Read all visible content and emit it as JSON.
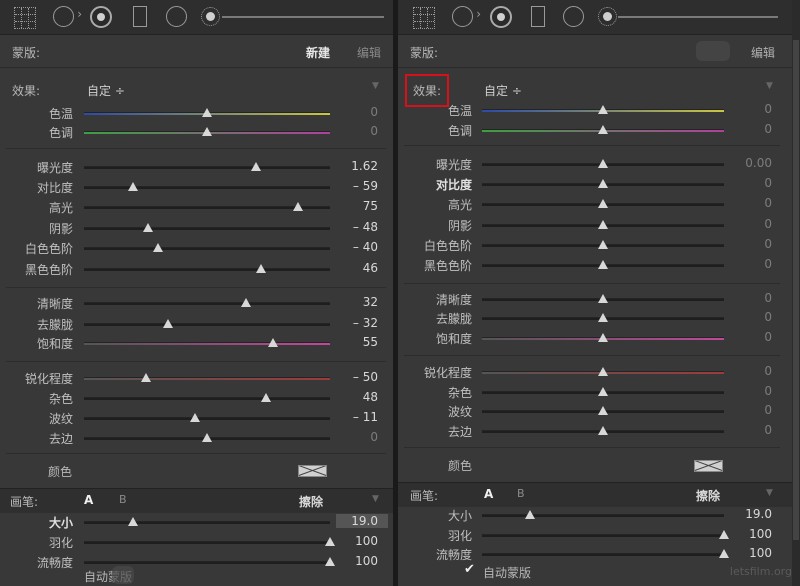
{
  "left": {
    "mask_label": "蒙版:",
    "mask_new": "新建",
    "mask_edit": "编辑",
    "effect_label": "效果:",
    "effect_value": "自定 ÷",
    "sliders": [
      {
        "label": "色温",
        "value": "0",
        "pos": 0.5,
        "gradient": [
          "#2c4aa8",
          "#c9c640"
        ],
        "dim": true
      },
      {
        "label": "色调",
        "value": "0",
        "pos": 0.5,
        "gradient": [
          "#3ba040",
          "#b0409e"
        ],
        "dim": true
      },
      {
        "label": "曝光度",
        "value": "1.62",
        "pos": 0.7
      },
      {
        "label": "对比度",
        "value": "– 59",
        "pos": 0.2
      },
      {
        "label": "高光",
        "value": "75",
        "pos": 0.87
      },
      {
        "label": "阴影",
        "value": "– 48",
        "pos": 0.26
      },
      {
        "label": "白色色阶",
        "value": "– 40",
        "pos": 0.3
      },
      {
        "label": "黑色色阶",
        "value": "46",
        "pos": 0.72
      },
      {
        "label": "清晰度",
        "value": "32",
        "pos": 0.66
      },
      {
        "label": "去朦胧",
        "value": "– 32",
        "pos": 0.34
      },
      {
        "label": "饱和度",
        "value": "55",
        "pos": 0.77,
        "gradient": [
          "#555",
          "#c2479c"
        ]
      },
      {
        "label": "锐化程度",
        "value": "– 50",
        "pos": 0.25,
        "gradient": [
          "#555",
          "#9c3b3b"
        ]
      },
      {
        "label": "杂色",
        "value": "48",
        "pos": 0.74
      },
      {
        "label": "波纹",
        "value": "– 11",
        "pos": 0.45
      },
      {
        "label": "去边",
        "value": "0",
        "pos": 0.5,
        "dim": true
      }
    ],
    "color_label": "颜色",
    "brush_label": "画笔:",
    "brush_a": "A",
    "brush_b": "B",
    "brush_erase": "擦除",
    "brush_sliders": [
      {
        "label": "大小",
        "value": "19.0",
        "pos": 0.2,
        "bold": true
      },
      {
        "label": "羽化",
        "value": "100",
        "pos": 1.0
      },
      {
        "label": "流畅度",
        "value": "100",
        "pos": 1.0
      }
    ],
    "auto_mask": "自动蒙版"
  },
  "right": {
    "mask_label": "蒙版:",
    "mask_edit": "编辑",
    "effect_label": "效果:",
    "effect_value": "自定 ÷",
    "sliders": [
      {
        "label": "色温",
        "value": "0",
        "pos": 0.5,
        "gradient": [
          "#2c4aa8",
          "#c9c640"
        ],
        "dim": true
      },
      {
        "label": "色调",
        "value": "0",
        "pos": 0.5,
        "gradient": [
          "#3ba040",
          "#b0409e"
        ],
        "dim": true
      },
      {
        "label": "曝光度",
        "value": "0.00",
        "pos": 0.5,
        "dim": true
      },
      {
        "label": "对比度",
        "value": "0",
        "pos": 0.5,
        "dim": true,
        "bold": true
      },
      {
        "label": "高光",
        "value": "0",
        "pos": 0.5,
        "dim": true
      },
      {
        "label": "阴影",
        "value": "0",
        "pos": 0.5,
        "dim": true
      },
      {
        "label": "白色色阶",
        "value": "0",
        "pos": 0.5,
        "dim": true
      },
      {
        "label": "黑色色阶",
        "value": "0",
        "pos": 0.5,
        "dim": true
      },
      {
        "label": "清晰度",
        "value": "0",
        "pos": 0.5,
        "dim": true
      },
      {
        "label": "去朦胧",
        "value": "0",
        "pos": 0.5,
        "dim": true
      },
      {
        "label": "饱和度",
        "value": "0",
        "pos": 0.5,
        "dim": true,
        "gradient": [
          "#555",
          "#c2479c"
        ]
      },
      {
        "label": "锐化程度",
        "value": "0",
        "pos": 0.5,
        "dim": true,
        "gradient": [
          "#555",
          "#9c3b3b"
        ]
      },
      {
        "label": "杂色",
        "value": "0",
        "pos": 0.5,
        "dim": true
      },
      {
        "label": "波纹",
        "value": "0",
        "pos": 0.5,
        "dim": true
      },
      {
        "label": "去边",
        "value": "0",
        "pos": 0.5,
        "dim": true
      }
    ],
    "color_label": "颜色",
    "brush_label": "画笔:",
    "brush_a": "A",
    "brush_b": "B",
    "brush_erase": "擦除",
    "brush_sliders": [
      {
        "label": "大小",
        "value": "19.0",
        "pos": 0.2
      },
      {
        "label": "羽化",
        "value": "100",
        "pos": 1.0
      },
      {
        "label": "流畅度",
        "value": "100",
        "pos": 1.0
      }
    ],
    "auto_mask_check": "✔",
    "auto_mask": "自动蒙版"
  },
  "watermark": "letsfilm.org",
  "colors": {
    "highlight": "#d8101a",
    "panel": "#383838",
    "toolbar": "#2e2e2e"
  }
}
